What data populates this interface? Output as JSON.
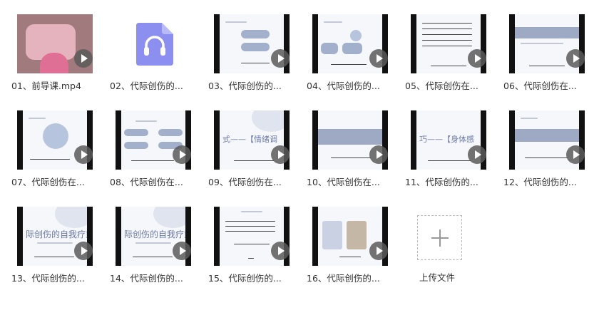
{
  "files": [
    {
      "name": "01、前导课.mp4",
      "type": "video",
      "thumb": "face"
    },
    {
      "name": "02、代际创伤的...",
      "type": "audio",
      "thumb": "audio"
    },
    {
      "name": "03、代际创伤的...",
      "type": "video",
      "thumb": "slide-a"
    },
    {
      "name": "04、代际创伤的...",
      "type": "video",
      "thumb": "slide-b"
    },
    {
      "name": "05、代际创伤在...",
      "type": "video",
      "thumb": "slide-c"
    },
    {
      "name": "06、代际创伤在...",
      "type": "video",
      "thumb": "slide-d"
    },
    {
      "name": "07、代际创伤在...",
      "type": "video",
      "thumb": "slide-e"
    },
    {
      "name": "08、代际创伤在...",
      "type": "video",
      "thumb": "slide-f"
    },
    {
      "name": "09、代际创伤在...",
      "type": "video",
      "thumb": "slide-g"
    },
    {
      "name": "10、代际创伤在...",
      "type": "video",
      "thumb": "slide-h"
    },
    {
      "name": "11、代际创伤的...",
      "type": "video",
      "thumb": "slide-i"
    },
    {
      "name": "12、代际创伤的...",
      "type": "video",
      "thumb": "slide-j"
    },
    {
      "name": "13、代际创伤的...",
      "type": "video",
      "thumb": "slide-k"
    },
    {
      "name": "14、代际创伤的...",
      "type": "video",
      "thumb": "slide-k"
    },
    {
      "name": "15、代际创伤的...",
      "type": "video",
      "thumb": "slide-l"
    },
    {
      "name": "16、代际创伤的...",
      "type": "video",
      "thumb": "slide-m"
    }
  ],
  "upload": {
    "label": "上传文件",
    "icon": "plus-icon"
  },
  "colors": {
    "audio_icon": "#8d8ff0",
    "play_button": "#5a5a5a",
    "slide_accent": "#9eaac4"
  }
}
